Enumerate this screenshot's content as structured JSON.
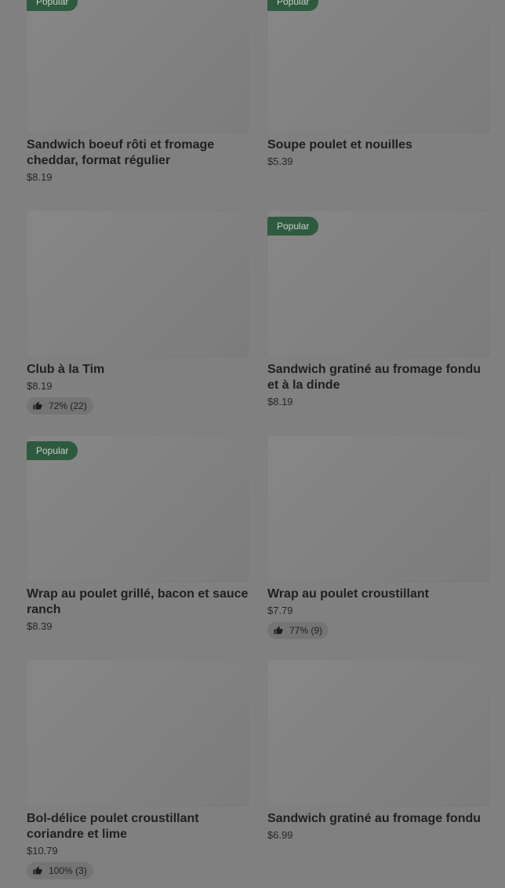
{
  "items": [
    {
      "name": "Sandwich boeuf rôti et fromage cheddar, format régulier",
      "price": "$8.19",
      "badge": "Popular",
      "rating": ""
    },
    {
      "name": "Soupe poulet et nouilles",
      "price": "$5.39",
      "badge": "Popular",
      "rating": ""
    },
    {
      "name": "Club à la Tim",
      "price": "$8.19",
      "badge": "",
      "rating": "72% (22)"
    },
    {
      "name": "Sandwich gratiné au fromage fondu et à la dinde",
      "price": "$8.19",
      "badge": "Popular",
      "rating": ""
    },
    {
      "name": "Wrap au poulet grillé, bacon et sauce ranch",
      "price": "$8.39",
      "badge": "Popular",
      "rating": ""
    },
    {
      "name": "Wrap au poulet croustillant",
      "price": "$7.79",
      "badge": "",
      "rating": "77% (9)"
    },
    {
      "name": "Bol-délice poulet croustillant coriandre et lime",
      "price": "$10.79",
      "badge": "",
      "rating": "100% (3)"
    },
    {
      "name": "Sandwich gratiné au fromage fondu",
      "price": "$6.99",
      "badge": "",
      "rating": ""
    }
  ],
  "icons": {
    "rating": "thumbs-up-icon",
    "image": "product-image"
  }
}
